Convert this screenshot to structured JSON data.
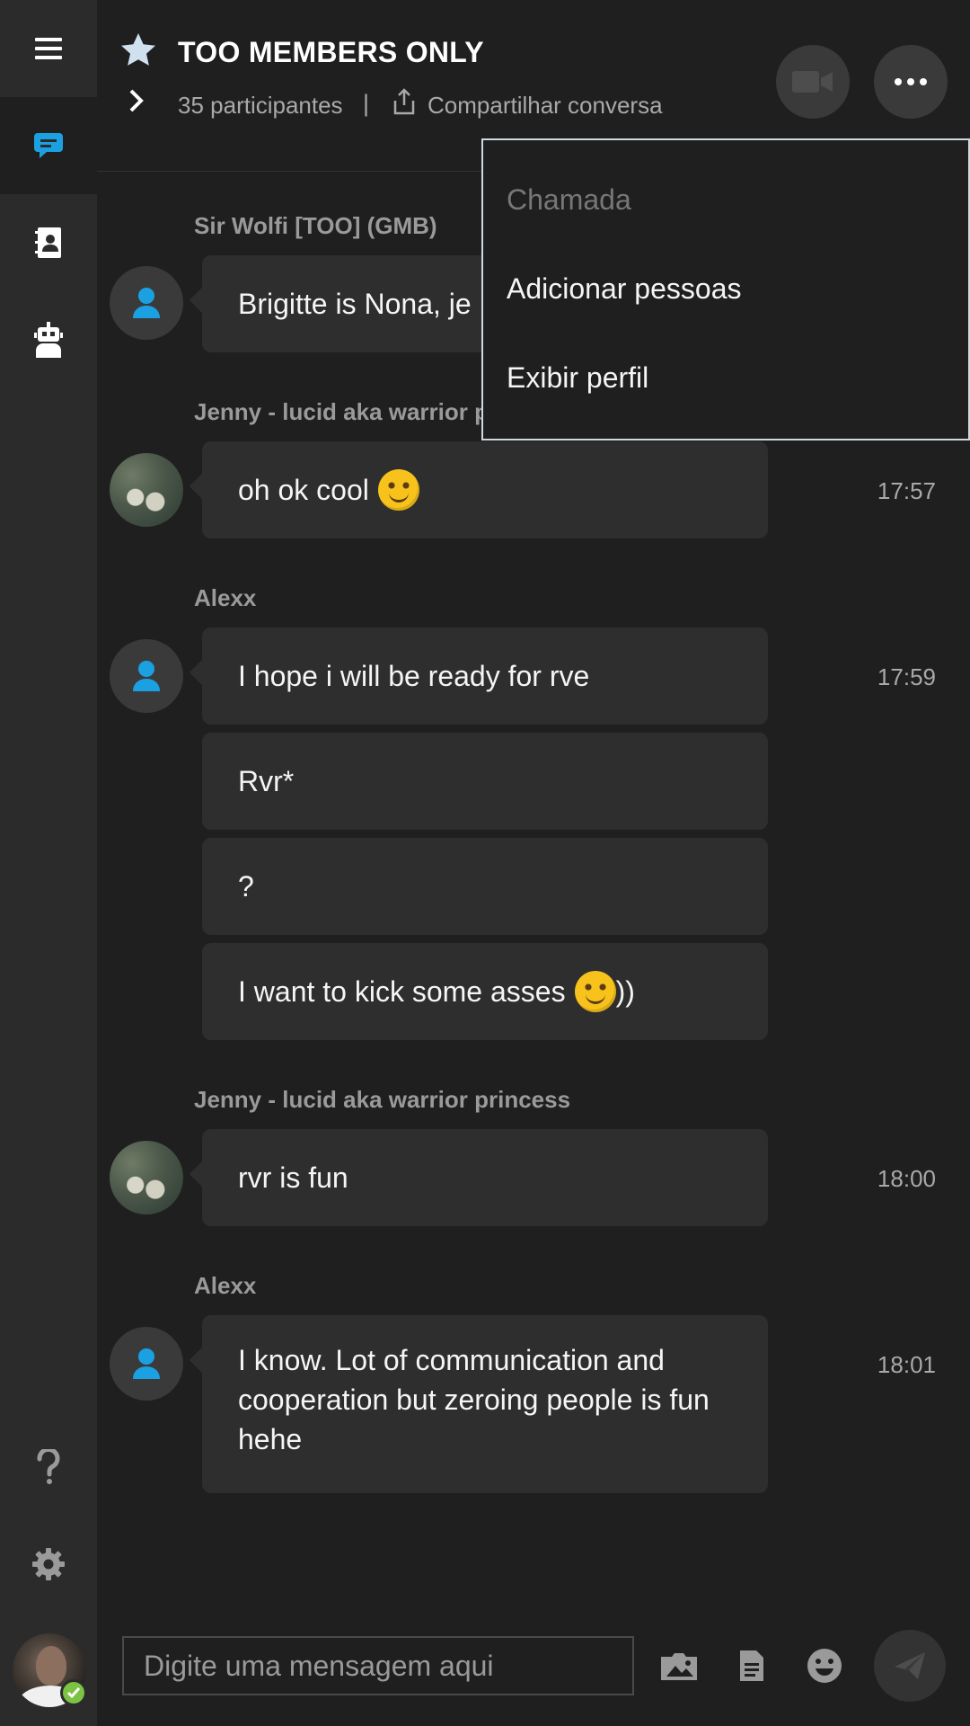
{
  "header": {
    "title": "TOO MEMBERS ONLY",
    "participants": "35 participantes",
    "separator": "|",
    "share": "Compartilhar conversa"
  },
  "menu": {
    "items": [
      {
        "label": "Chamada",
        "enabled": false
      },
      {
        "label": "Adicionar pessoas",
        "enabled": true
      },
      {
        "label": "Exibir perfil",
        "enabled": true
      }
    ]
  },
  "messages": [
    {
      "sender": "Sir Wolfi [TOO] (GMB)",
      "text": "Brigitte is Nona, je",
      "time": ""
    },
    {
      "sender": "Jenny - lucid aka warrior p",
      "text": "oh ok cool",
      "emoji": "smile-emoji",
      "time": "17:57"
    },
    {
      "sender": "Alexx",
      "bubbles": [
        {
          "text": "I hope i will be ready for rve",
          "time": "17:59"
        },
        {
          "text": "Rvr*"
        },
        {
          "text": "?"
        },
        {
          "text": "I want to kick some asses",
          "emoji": "smile-emoji",
          "suffix": "))"
        }
      ]
    },
    {
      "sender": "Jenny - lucid aka warrior princess",
      "text": "rvr is fun",
      "time": "18:00"
    },
    {
      "sender": "Alexx",
      "text": "I know. Lot of communication and cooperation but zeroing people is fun hehe",
      "time": "18:01"
    }
  ],
  "composer": {
    "placeholder": "Digite uma mensagem aqui"
  },
  "icons": {
    "accent": "#1ba1e2",
    "presence": "#7cc243"
  }
}
